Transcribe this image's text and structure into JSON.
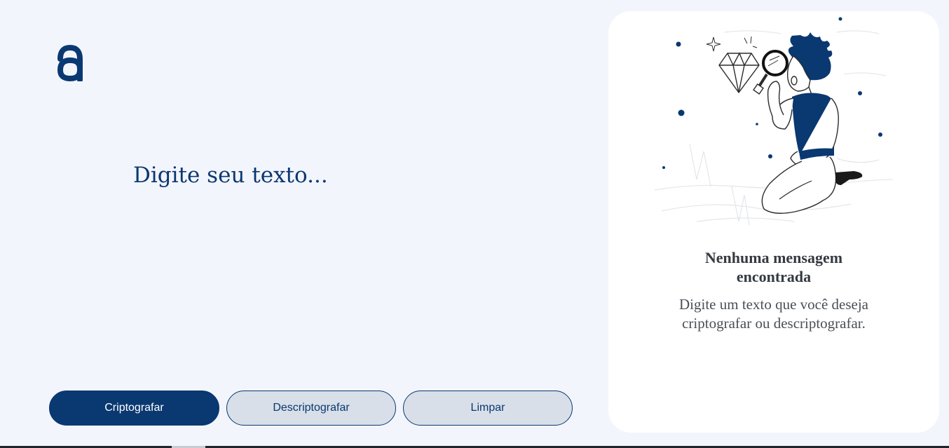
{
  "brand": {
    "logo_icon": "alura-logo-icon",
    "logo_color": "#0a3871"
  },
  "input": {
    "placeholder": "Digite seu texto...",
    "value": ""
  },
  "actions": {
    "encrypt_label": "Criptografar",
    "decrypt_label": "Descriptografar",
    "clear_label": "Limpar"
  },
  "output": {
    "illustration_icon": "person-magnifying-glass-diamond-illustration",
    "empty_title": "Nenhuma mensagem encontrada",
    "empty_text": "Digite um texto que você deseja criptografar ou descriptografar."
  },
  "colors": {
    "primary": "#0a3871",
    "background": "#f3f5fc",
    "secondary_button": "#d8dfe8",
    "panel": "#ffffff"
  }
}
